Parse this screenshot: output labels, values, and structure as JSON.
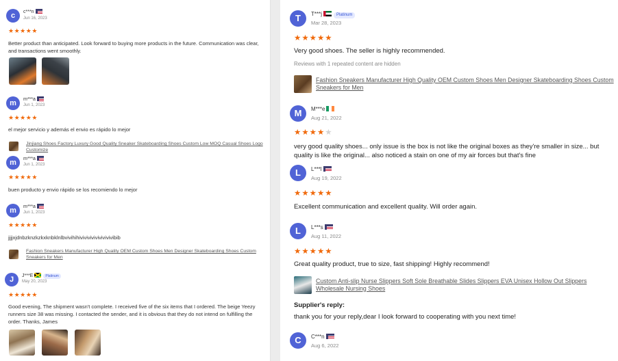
{
  "colors": {
    "avatar": "#5063d6",
    "star": "#f06a0c",
    "badge_text": "#3857d6"
  },
  "left_reviews": [
    {
      "initial": "c",
      "name": "c***n",
      "flag": "us",
      "date": "Jun 16, 2023",
      "stars": 5,
      "text": "Better product than anticipated. Look forward to buying more products in the future. Communication was clear, and transactions went smoothly."
    },
    {
      "initial": "m",
      "name": "m***a",
      "flag": "us",
      "date": "Jun 1, 2023",
      "stars": 5,
      "text": "el mejor servicio y además el envio es rápido lo mejor",
      "product": "Jinjiang Shoes Factory Luxury Good Quality Sneaker Skateboarding Shoes Custom Low MOQ Casual Shoes Logo Customize"
    },
    {
      "initial": "m",
      "name": "m***a",
      "flag": "us",
      "date": "Jun 1, 2023",
      "stars": 5,
      "text": "buen producto y envio rápido se los recomiendo lo mejor"
    },
    {
      "initial": "m",
      "name": "m***a",
      "flag": "us",
      "date": "Jun 1, 2023",
      "stars": 5,
      "text": "jjjjxjdnbzknzkzkxknbklnlbvivihihivivivivivivivivivibib",
      "product": "Fashion Sneakers Manufacturer High Quality OEM Custom Shoes Men Designer Skateboarding Shoes Custom Sneakers for Men"
    },
    {
      "initial": "J",
      "name": "J***E",
      "flag": "jm",
      "badge": "Platinum",
      "date": "May 20, 2023",
      "stars": 5,
      "text": "Good evening, The shipment wasn't complete. I received five of the six items that I ordered. The beige Yeezy runners size 38 was missing. I contacted the sender, and it is obvious that they do not intend on fulfilling the order. Thanks, James"
    }
  ],
  "right_reviews": [
    {
      "initial": "T",
      "name": "T***j",
      "flag": "ae",
      "badge": "Platinum",
      "date": "Mar 28, 2023",
      "stars": 5,
      "text": "Very good shoes. The seller is highly recommended.",
      "note": "Reviews with 1 repeated content are hidden",
      "product": "Fashion Sneakers Manufacturer High Quality OEM Custom Shoes Men Designer Skateboarding Shoes Custom Sneakers for Men"
    },
    {
      "initial": "M",
      "name": "M***e",
      "flag": "ie",
      "date": "Aug 21, 2022",
      "stars": 4,
      "text": "very good quality shoes... only issue is the box is not like the original boxes as they're smaller in size... but quality is like the original... also noticed a stain on one of my air forces but that's fine"
    },
    {
      "initial": "L",
      "name": "L***l",
      "flag": "us",
      "date": "Aug 19, 2022",
      "stars": 5,
      "text": "Excellent communication and excellent quality. Will order again."
    },
    {
      "initial": "L",
      "name": "L***s",
      "flag": "us",
      "date": "Aug 11, 2022",
      "stars": 5,
      "text": "Great quality product, true to size, fast shipping! Highly recommend!",
      "product": "Custom Anti-slip Nurse Slippers Soft Sole Breathable Slides Slippers EVA Unisex Hollow Out Slippers Wholesale Nursing Shoes",
      "reply_label": "Supplier's reply:",
      "reply": "thank you for your reply,dear I look forward to cooperating with you next time!"
    },
    {
      "initial": "C",
      "name": "C***n",
      "flag": "us",
      "date": "Aug 6, 2022"
    }
  ]
}
